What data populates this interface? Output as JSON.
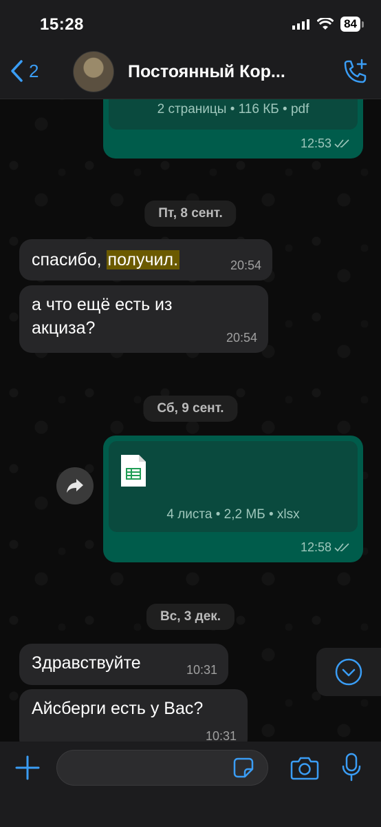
{
  "status": {
    "time": "15:28",
    "battery": "84"
  },
  "header": {
    "back_count": "2",
    "title": "Постоянный Кор..."
  },
  "messages": {
    "m1": {
      "doc_info": "2 страницы • 116 КБ • pdf",
      "time": "12:53"
    },
    "date1": "Пт, 8 сент.",
    "m2": {
      "text_before": "спасибо, ",
      "text_highlight": "получил.",
      "time": "20:54"
    },
    "m3": {
      "text": "а что ещё есть из акциза?",
      "time": "20:54"
    },
    "date2": "Сб, 9 сент.",
    "m4": {
      "doc_info": "4 листа • 2,2 МБ • xlsx",
      "time": "12:58"
    },
    "date3": "Вс, 3 дек.",
    "m5": {
      "text": "Здравствуйте",
      "time": "10:31"
    },
    "m6": {
      "text": "Айсберги есть у Вас?",
      "time": "10:31"
    }
  },
  "input": {
    "placeholder": ""
  },
  "colors": {
    "accent": "#3a9df5",
    "outgoing": "#005c4b",
    "incoming": "#262628"
  }
}
